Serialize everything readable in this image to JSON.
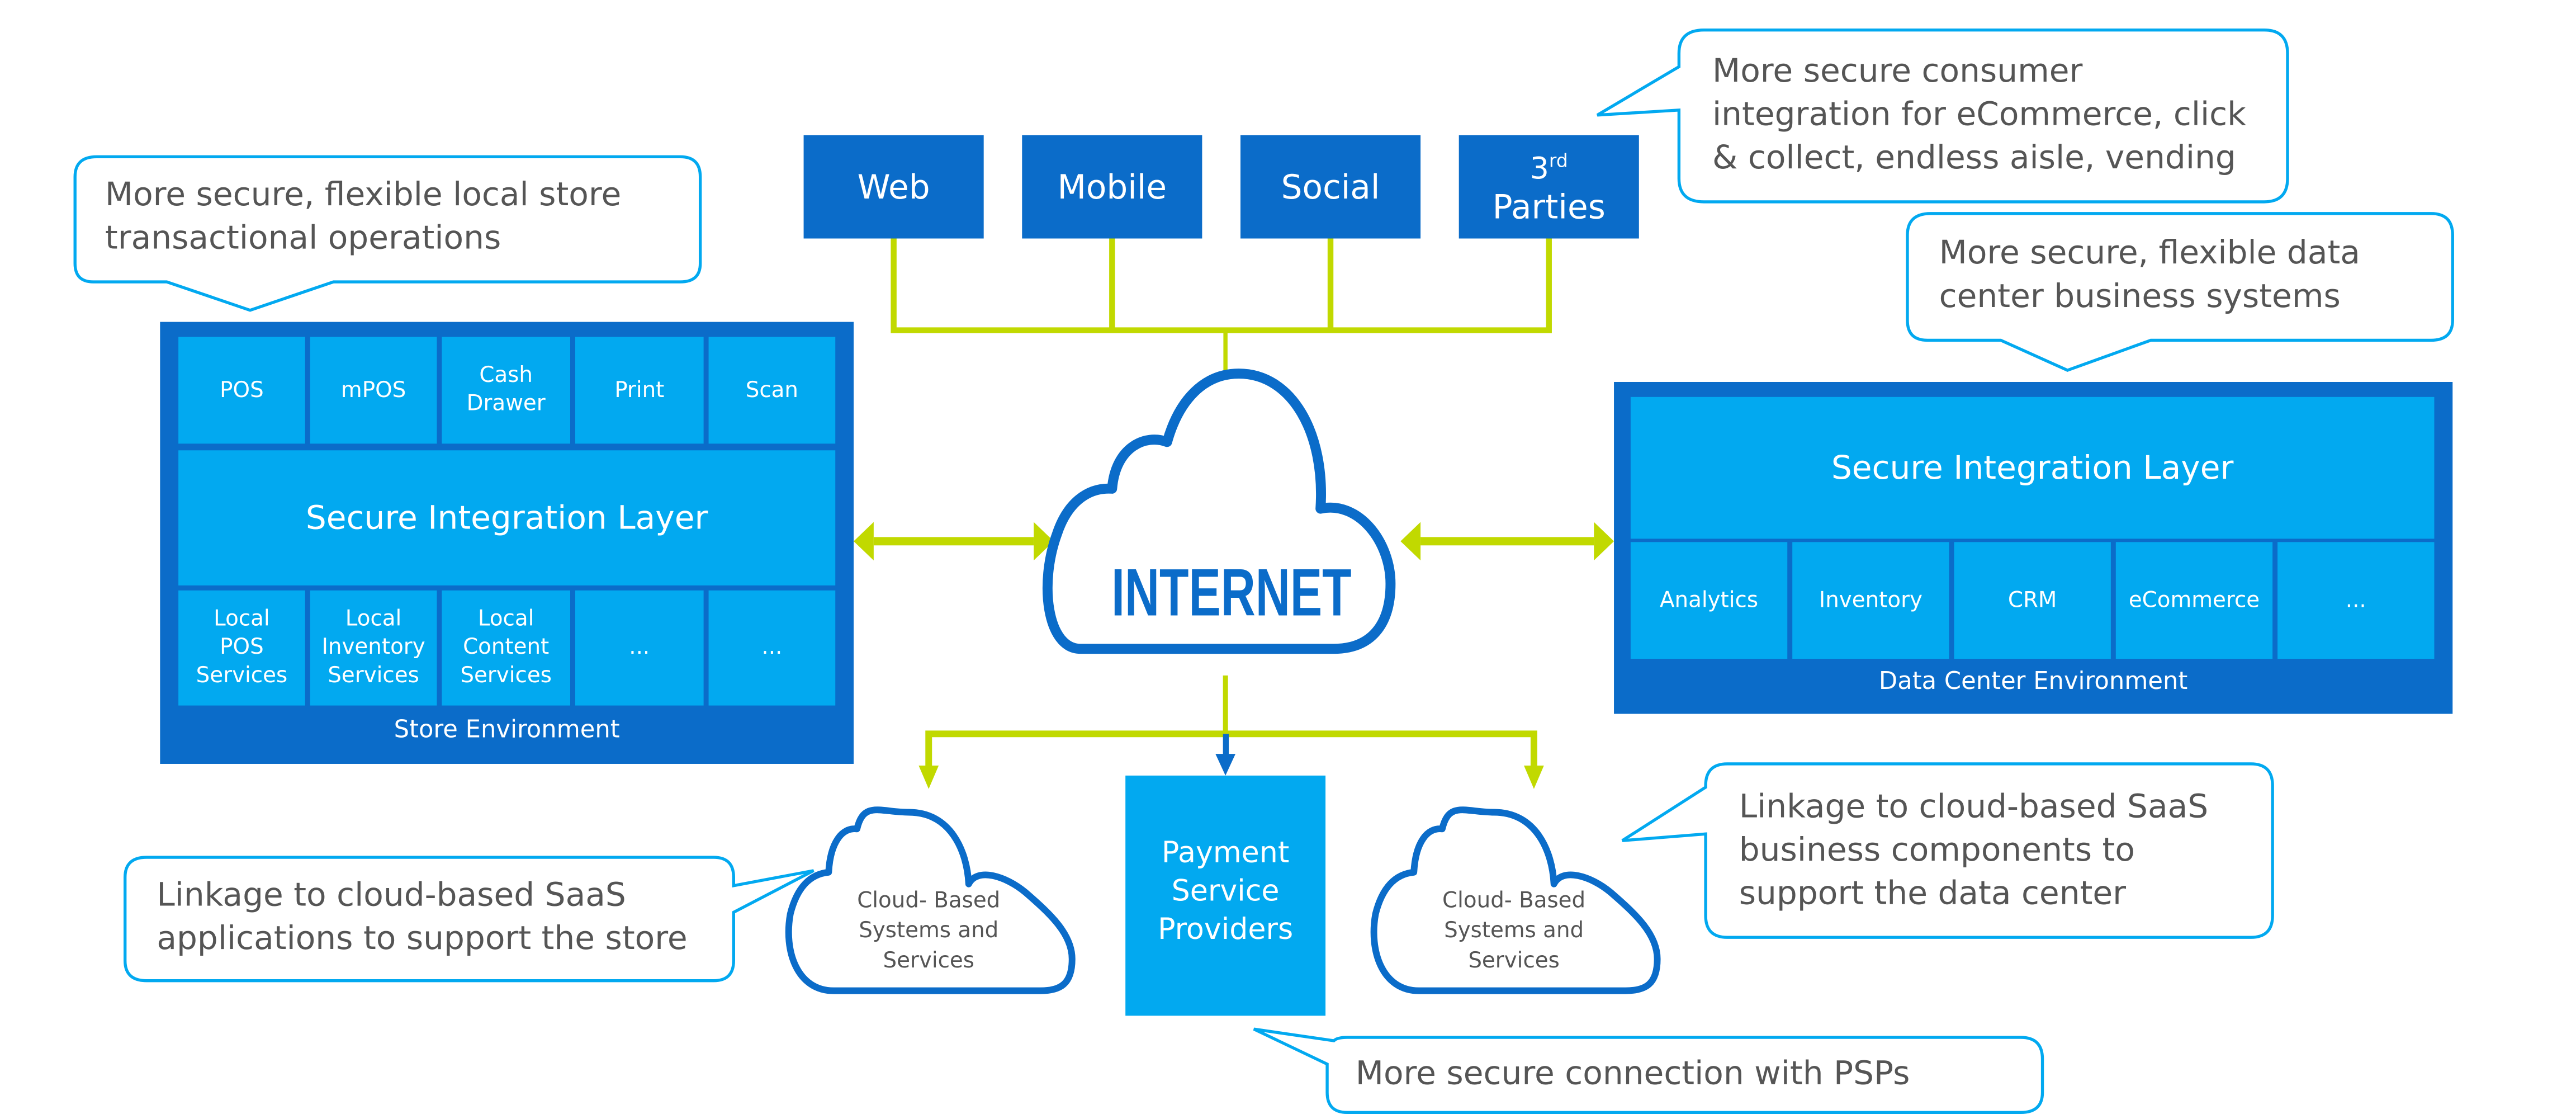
{
  "colors": {
    "dark_blue": "#0b6cc9",
    "light_blue": "#02a9f0",
    "connector_green": "#c1d900",
    "callout_border": "#02a9f0",
    "callout_text": "#555555"
  },
  "channels": [
    {
      "label": "Web"
    },
    {
      "label": "Mobile"
    },
    {
      "label": "Social"
    },
    {
      "label_sup_base": "3",
      "label_sup": "rd",
      "label_line2": "Parties"
    }
  ],
  "store": {
    "top_row": [
      "POS",
      "mPOS",
      "Cash\nDrawer",
      "Print",
      "Scan"
    ],
    "integration_layer": "Secure Integration Layer",
    "bottom_row": [
      "Local\nPOS\nServices",
      "Local\nInventory\nServices",
      "Local\nContent\nServices",
      "...",
      "..."
    ],
    "environment_label": "Store Environment"
  },
  "datacenter": {
    "integration_layer": "Secure Integration Layer",
    "bottom_row": [
      "Analytics",
      "Inventory",
      "CRM",
      "eCommerce",
      "..."
    ],
    "environment_label": "Data Center Environment"
  },
  "internet": {
    "label": "INTERNET"
  },
  "cloud_services": {
    "left": "Cloud- Based\nSystems and\nServices",
    "right": "Cloud- Based\nSystems and\nServices"
  },
  "psp": {
    "label": "Payment\nService\nProviders"
  },
  "callouts": {
    "store": "More secure, flexible local store\ntransactional operations",
    "consumer": "More secure consumer\nintegration for eCommerce, click\n& collect, endless aisle, vending",
    "datacenter": "More secure, flexible data\ncenter business systems",
    "saas_store": "Linkage to cloud-based SaaS\napplications to support the store",
    "saas_datacenter": "Linkage to cloud-based SaaS\nbusiness components to\nsupport the data center",
    "psp": "More secure connection with PSPs"
  }
}
